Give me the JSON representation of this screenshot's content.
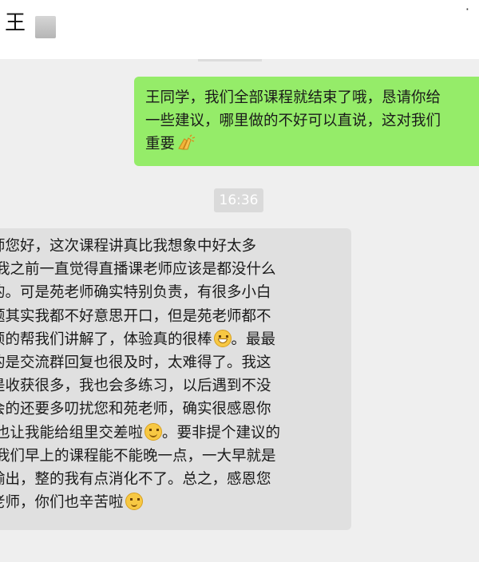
{
  "header": {
    "title": "王"
  },
  "messages": {
    "sent": {
      "lines": [
        "王同学，我们全部课程就结束了哦，恳请你给",
        "一些建议，哪里做的不好可以直说，这对我们",
        "重要"
      ]
    },
    "time": "16:36",
    "received": {
      "lines": [
        "师您好，这次课程讲真比我想象中好太多",
        "我之前一直觉得直播课老师应该是都没什么",
        "的。可是苑老师确实特别负责，有很多小白",
        "题其实我都不好意思开口，但是苑老师都不",
        "烦的帮我们讲解了，体验真的很棒",
        "的是交流群回复也很及时，太难得了。我这",
        "是收获很多，我也会多练习，以后遇到不没",
        "会的还要多叨扰您和苑老师，确实很感恩你",
        "也让我能给组里交差啦",
        "我们早上的课程能不能晚一点，一大早就是",
        "输出，整的我有点消化不了。总之，感恩您",
        "老师，你们也辛苦啦"
      ],
      "after_emoji_line5": "。最最",
      "after_emoji_line9": "。要非提个建议的"
    }
  },
  "icons": {
    "clap": "clapping-hands-icon",
    "grin": "grinning-face-icon",
    "smile": "smiling-face-icon",
    "slight": "slightly-smiling-face-icon"
  },
  "colors": {
    "sent_bubble": "#95ec69",
    "received_bubble": "#e0e0e0",
    "background": "#efefef"
  }
}
